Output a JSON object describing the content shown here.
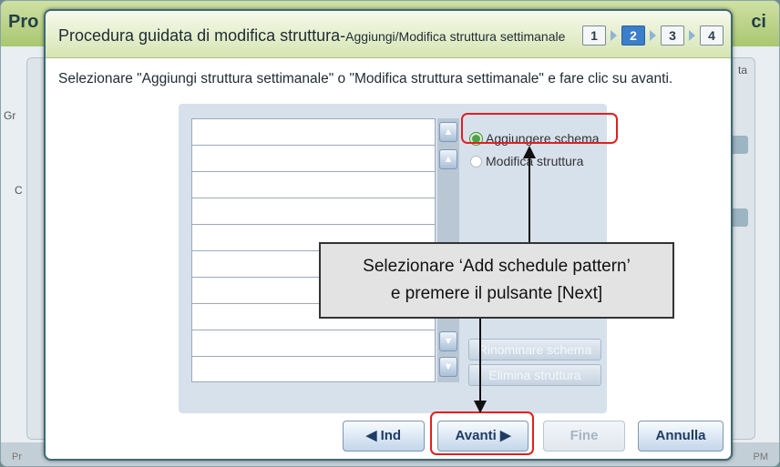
{
  "background": {
    "title": "Pro",
    "right_label": "ci",
    "tab_label": "ta",
    "left_label_1": "Gr",
    "left_label_2": "C",
    "footer_left": "Pr",
    "footer_right": "PM"
  },
  "dialog": {
    "title": "Procedura guidata di modifica struttura-",
    "subtitle": "Aggiungi/Modifica struttura settimanale",
    "steps": [
      "1",
      "2",
      "3",
      "4"
    ],
    "instruction": "Selezionare \"Aggiungi struttura settimanale\" o \"Modifica struttura settimanale\" e fare clic su avanti.",
    "options": {
      "add_label": "Aggiungere schema",
      "modify_label": "Modifica struttura"
    },
    "side_buttons": {
      "rename": "Rinominare schema",
      "delete": "Elimina struttura"
    },
    "footer": {
      "back": "◀ Ind",
      "next": "Avanti ▶",
      "finish": "Fine",
      "cancel": "Annulla"
    }
  },
  "callout": {
    "line1": "Selezionare ‘Add schedule pattern’",
    "line2": "e premere il pulsante [Next]"
  },
  "colors": {
    "highlight": "#e02020",
    "header_green": "#d6e5b2",
    "active_step": "#3b7ec9"
  }
}
